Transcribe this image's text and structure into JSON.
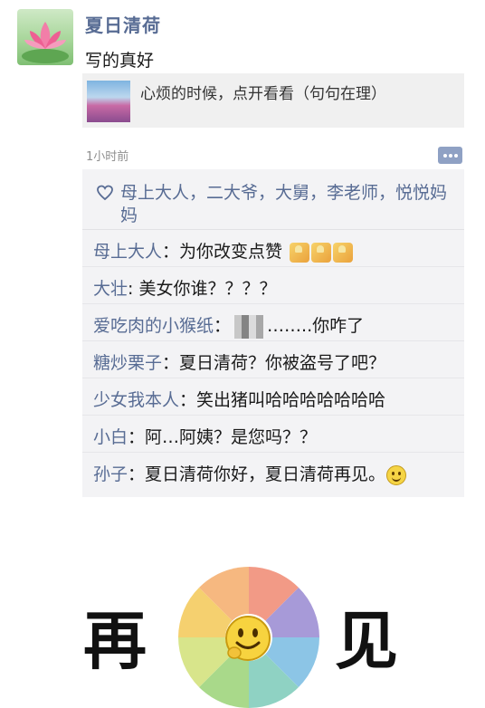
{
  "post": {
    "username": "夏日清荷",
    "text": "写的真好",
    "share_title": "心烦的时候，点开看看（句句在理）",
    "timestamp": "1小时前"
  },
  "likes": {
    "names": "母上大人，二大爷，大舅，李老师，悦悦妈妈"
  },
  "comments": [
    {
      "name": "母上大人",
      "sep": "：",
      "text": "为你改变点赞"
    },
    {
      "name": "大壮",
      "sep": ": ",
      "text": "美女你谁？？？？"
    },
    {
      "name": "爱吃肉的小猴纸",
      "sep": "：",
      "text": "……..你咋了"
    },
    {
      "name": "糖炒栗子",
      "sep": "：",
      "text": "夏日清荷？你被盗号了吧？"
    },
    {
      "name": "少女我本人",
      "sep": "：",
      "text": "笑出猪叫哈哈哈哈哈哈哈"
    },
    {
      "name": "小白",
      "sep": "：",
      "text": "阿…阿姨？是您吗？？"
    },
    {
      "name": "孙子",
      "sep": "：",
      "text": "夏日清荷你好，夏日清荷再见。"
    }
  ],
  "sticker": {
    "left_char": "再",
    "right_char": "见"
  },
  "icons": {
    "avatar": "lotus-avatar",
    "share_thumb": "lavender-field-thumbnail",
    "comment": "comment-dots-icon",
    "like": "heart-outline-icon",
    "thumbs": "thumbs-up-emoji",
    "smile": "smile-emoji"
  },
  "colors": {
    "link_blue": "#586c94",
    "panel_bg": "#f3f3f5"
  }
}
